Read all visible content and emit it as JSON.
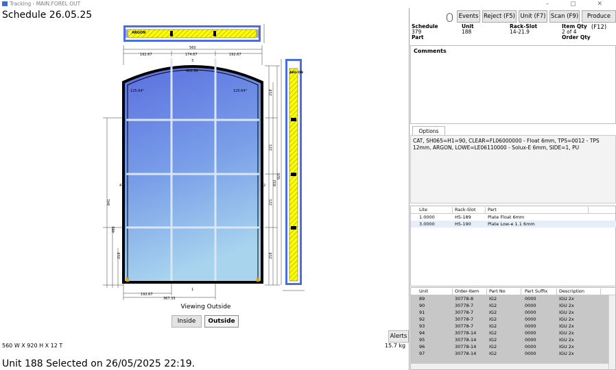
{
  "window": {
    "title": "Tracking - MAIN.FOREL OUT",
    "controls": "– ▢ ✕"
  },
  "schedule_title": "Schedule 26.05.25",
  "dimensions": "560 W X 920 H X 12 T",
  "weight": "15.7 kg",
  "status": "Unit 188 Selected on 26/05/2025 22:19.",
  "alerts_label": "Alerts",
  "viewing": {
    "label": "Viewing Outside",
    "inside": "Inside",
    "outside": "Outside",
    "selected": "Outside"
  },
  "drawing": {
    "top_section_label": "ARGON",
    "side_section_label": "ARG ON",
    "overall_width": "560",
    "upper_segments": [
      "192.67",
      "174.67",
      "192.67"
    ],
    "arc_label": "400.56",
    "arc_marker": "3",
    "corner_left": "125.64°",
    "corner_right": "125.64°",
    "bottom_marker": "1",
    "left_marker": "4",
    "right_marker": "2",
    "bottom_dim": "192.67",
    "bottom_dim2": "367.33",
    "left_dims": [
      "841",
      "480",
      "218"
    ],
    "right_dims": [
      "218",
      "221",
      "221",
      "218"
    ],
    "right_total": "920",
    "right_total2": "832"
  },
  "toolbar": {
    "events": "Events",
    "reject": "Reject (F5)",
    "unit": "Unit (F7)",
    "scan": "Scan (F9)",
    "produce": "Produce (F12)"
  },
  "header": {
    "schedule_label": "Schedule",
    "schedule_value": "379",
    "unit_label": "Unit",
    "unit_value": "188",
    "rack_label": "Rack-Slot",
    "rack_value": "14-21.9",
    "item_qty_label": "Item Qty",
    "item_qty_value": "2 of 4",
    "part_label": "Part",
    "order_qty_label": "Order Qty"
  },
  "comments_label": "Comments",
  "options": {
    "tab": "Options",
    "text": "CAT, SH065=H1=90, CLEAR=FL06000000 - Float 6mm, TPS=0012 - TPS 12mm, ARGON, LOWE=LE06110000 - Solux-E 6mm, SIDE=1, PU"
  },
  "lites": {
    "columns": [
      "Lite",
      "Rack-Slot",
      "Part"
    ],
    "rows": [
      {
        "lite": "1.0000",
        "rack": "H5-189",
        "part": "Plate Float 6mm"
      },
      {
        "lite": "3.0000",
        "rack": "H5-190",
        "part": "Plate Low-e 1.1 6mm"
      }
    ]
  },
  "units": {
    "columns": [
      "Unit",
      "Order-Item",
      "Part No",
      "Part Suffix",
      "Description"
    ],
    "rows": [
      {
        "unit": "89",
        "order": "30778-8",
        "part": "IG2",
        "suffix": "0000",
        "desc": "IGU 2x"
      },
      {
        "unit": "90",
        "order": "30778-7",
        "part": "IG2",
        "suffix": "0000",
        "desc": "IGU 2x"
      },
      {
        "unit": "91",
        "order": "30778-7",
        "part": "IG2",
        "suffix": "0000",
        "desc": "IGU 2x"
      },
      {
        "unit": "92",
        "order": "30778-7",
        "part": "IG2",
        "suffix": "0000",
        "desc": "IGU 2x"
      },
      {
        "unit": "93",
        "order": "30778-7",
        "part": "IG2",
        "suffix": "0000",
        "desc": "IGU 2x"
      },
      {
        "unit": "94",
        "order": "30778-14",
        "part": "IG2",
        "suffix": "0000",
        "desc": "IGU 2x"
      },
      {
        "unit": "95",
        "order": "30778-14",
        "part": "IG2",
        "suffix": "0000",
        "desc": "IGU 2x"
      },
      {
        "unit": "96",
        "order": "30778-14",
        "part": "IG2",
        "suffix": "0000",
        "desc": "IGU 2x"
      },
      {
        "unit": "97",
        "order": "30778-14",
        "part": "IG2",
        "suffix": "0000",
        "desc": "IGU 2x"
      }
    ]
  }
}
